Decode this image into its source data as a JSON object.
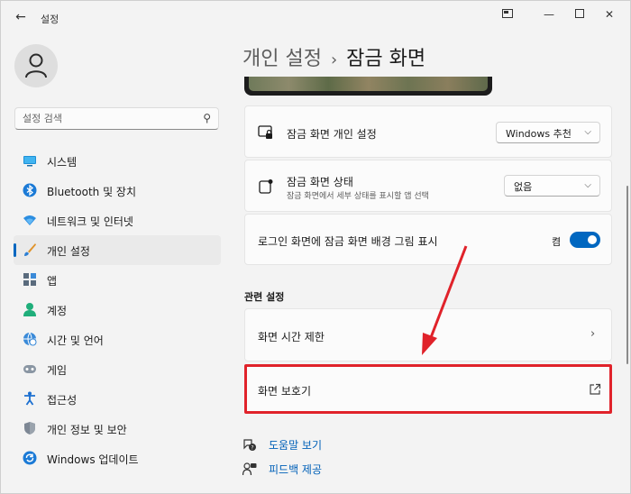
{
  "window": {
    "title": "설정"
  },
  "sidebar": {
    "search_placeholder": "설정 검색",
    "items": [
      {
        "label": "시스템",
        "icon": "system-icon"
      },
      {
        "label": "Bluetooth 및 장치",
        "icon": "bluetooth-icon"
      },
      {
        "label": "네트워크 및 인터넷",
        "icon": "network-icon"
      },
      {
        "label": "개인 설정",
        "icon": "brush-icon",
        "active": true
      },
      {
        "label": "앱",
        "icon": "apps-icon"
      },
      {
        "label": "계정",
        "icon": "account-icon"
      },
      {
        "label": "시간 및 언어",
        "icon": "globe-icon"
      },
      {
        "label": "게임",
        "icon": "gamepad-icon"
      },
      {
        "label": "접근성",
        "icon": "accessibility-icon"
      },
      {
        "label": "개인 정보 및 보안",
        "icon": "shield-icon"
      },
      {
        "label": "Windows 업데이트",
        "icon": "update-icon"
      }
    ]
  },
  "main": {
    "breadcrumb_parent": "개인 설정",
    "breadcrumb_separator": "›",
    "page_title": "잠금 화면",
    "settings": {
      "personalize": {
        "label": "잠금 화면 개인 설정",
        "value": "Windows 추천"
      },
      "status": {
        "label": "잠금 화면 상태",
        "description": "잠금 화면에서 세부 상태를 표시할 앱 선택",
        "value": "없음"
      },
      "signin_bg": {
        "label": "로그인 화면에 잠금 화면 배경 그림 표시",
        "toggle_label": "켬",
        "toggle_on": true
      }
    },
    "related_title": "관련 설정",
    "related": [
      {
        "label": "화면 시간 제한"
      },
      {
        "label": "화면 보호기"
      }
    ],
    "links": [
      {
        "label": "도움말 보기"
      },
      {
        "label": "피드백 제공"
      }
    ]
  },
  "colors": {
    "accent": "#0067c0",
    "highlight": "#e0222a"
  }
}
